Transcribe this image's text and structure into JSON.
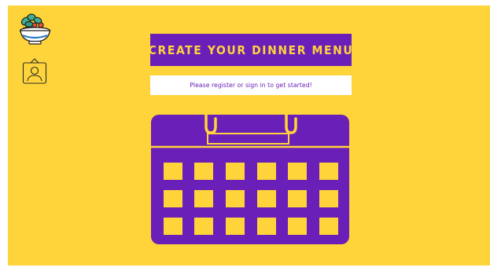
{
  "header": {
    "logo_icon": "salad-bowl-icon",
    "profile_icon": "user-profile-icon"
  },
  "main": {
    "title": "CREATE YOUR DINNER MENU",
    "signin_prompt": "Please register or sign in to get started!",
    "illustration_icon": "calendar-icon"
  },
  "colors": {
    "background": "#FFD43B",
    "accent": "#6A1FB8",
    "title_text": "#FFD43B",
    "prompt_background": "#FFFFFF"
  }
}
